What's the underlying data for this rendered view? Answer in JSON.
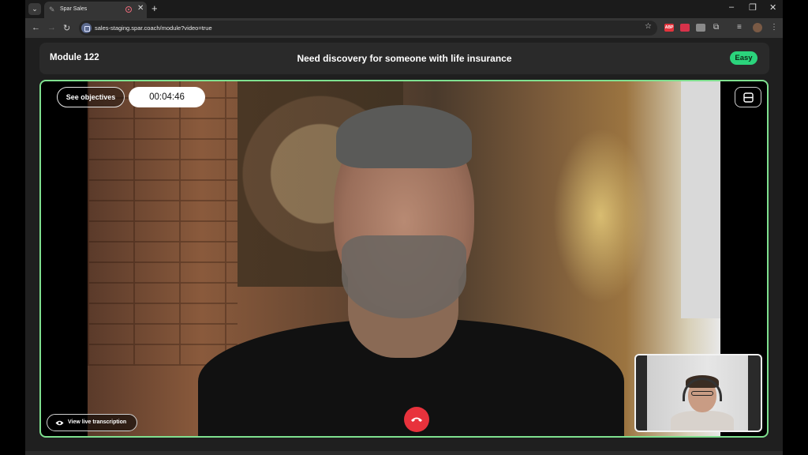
{
  "browser": {
    "tab_title": "Spar Sales",
    "tab_close": "✕",
    "new_tab": "+",
    "url": "sales-staging.spar.coach/module?video=true",
    "window_controls": {
      "minimize": "–",
      "restore": "❐",
      "close": "✕"
    },
    "extensions": [
      {
        "name": "abp-extension",
        "label": "ABP",
        "color": "#e5333c"
      },
      {
        "name": "red-extension",
        "label": "",
        "color": "#d8324a"
      },
      {
        "name": "gray-extension",
        "label": "",
        "color": "#8a8a8a"
      }
    ]
  },
  "module": {
    "name": "Module 122",
    "title": "Need discovery for someone with life insurance",
    "difficulty": "Easy",
    "difficulty_color": "#2bd47c"
  },
  "call": {
    "objectives_label": "See objectives",
    "timer": "00:04:46",
    "transcription_label": "View live transcription",
    "end_call_color": "#e8323c",
    "frame_color": "#7fe08f"
  }
}
